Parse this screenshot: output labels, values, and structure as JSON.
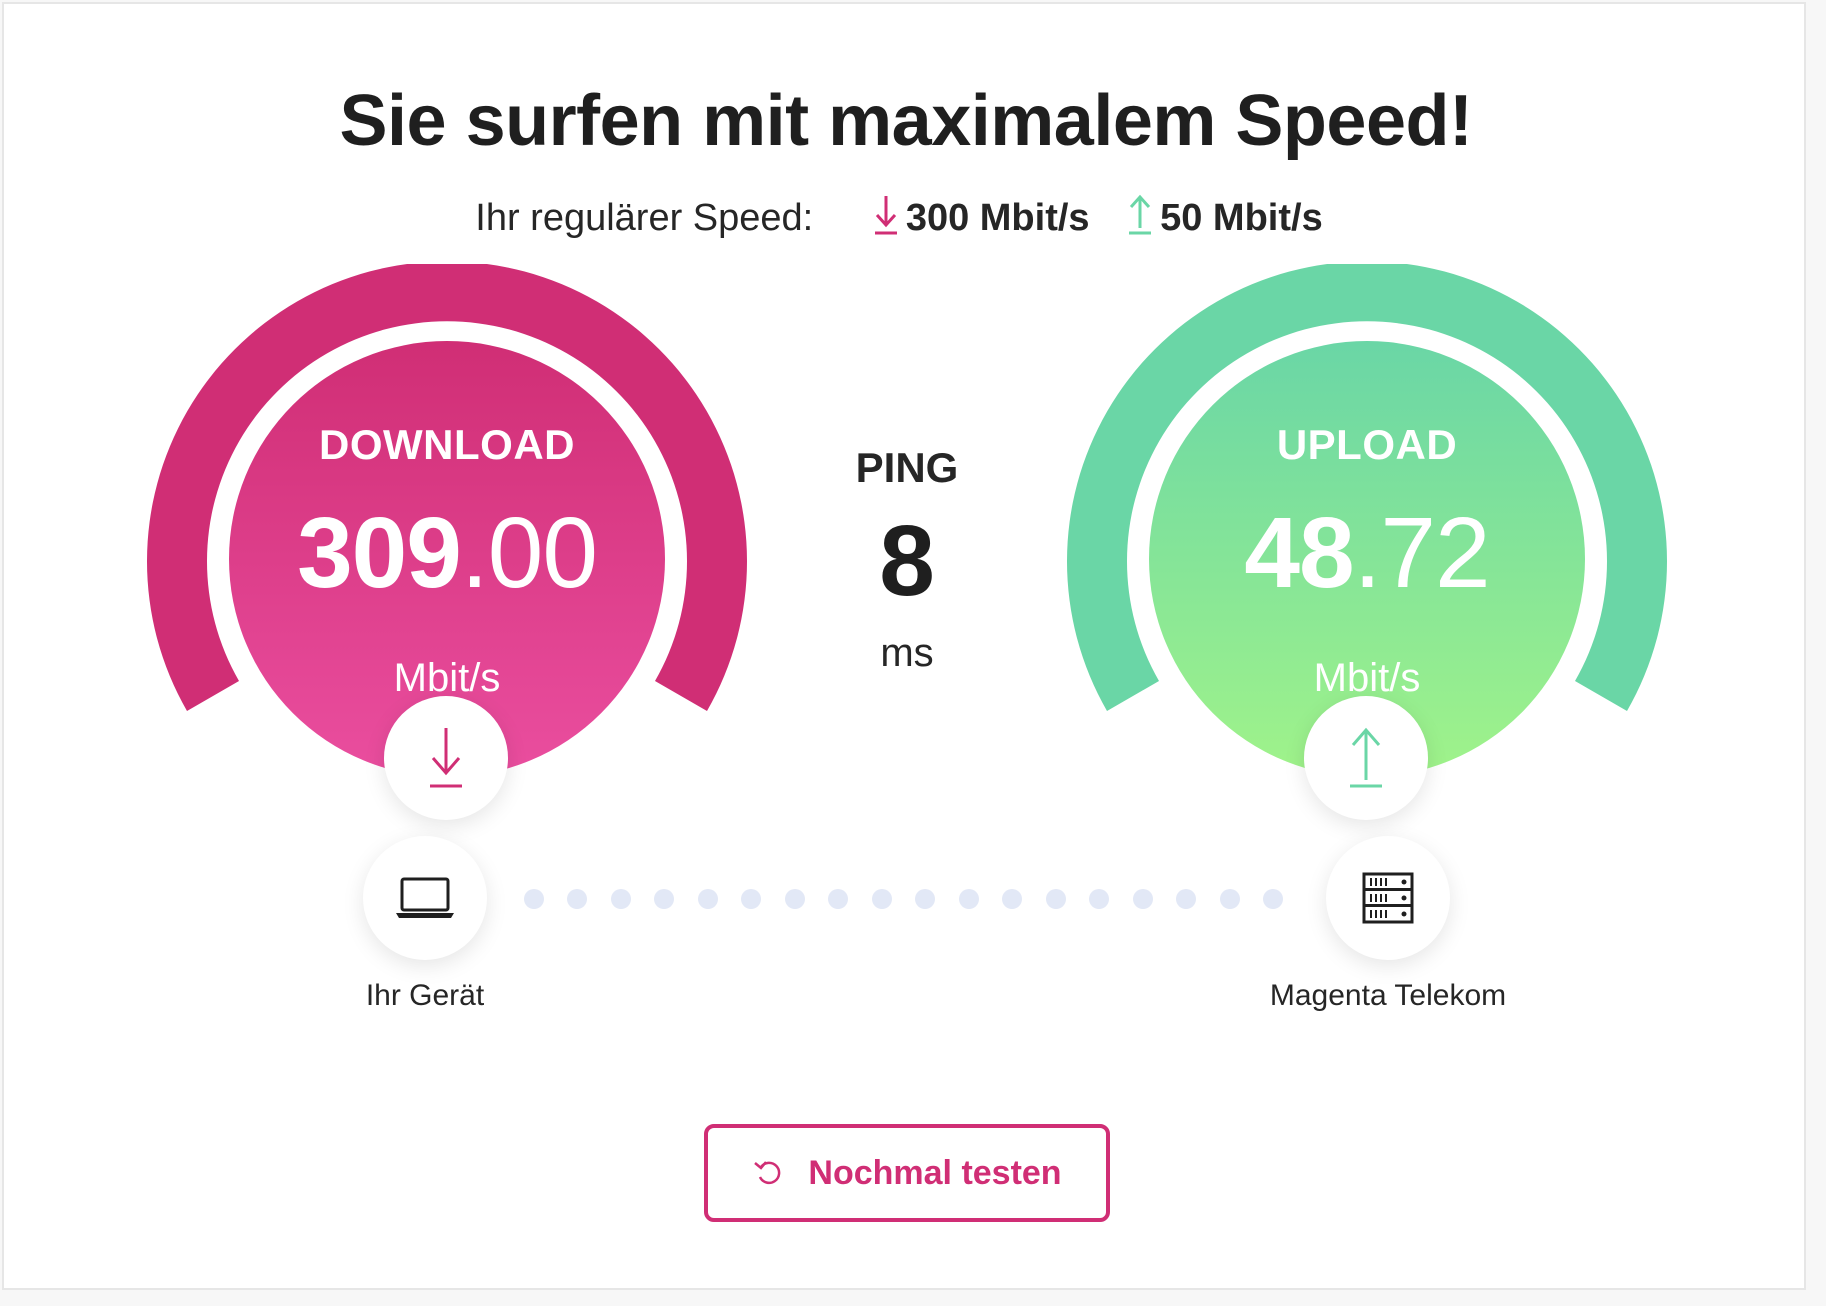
{
  "headline": "Sie surfen mit maximalem Speed!",
  "regular_speed": {
    "label": "Ihr regulärer Speed:",
    "download": "300 Mbit/s",
    "upload": "50 Mbit/s"
  },
  "download": {
    "label": "DOWNLOAD",
    "value_int": "309",
    "value_dec": ".00",
    "unit": "Mbit/s",
    "icon": "arrow-down-icon"
  },
  "upload": {
    "label": "UPLOAD",
    "value_int": "48",
    "value_dec": ".72",
    "unit": "Mbit/s",
    "icon": "arrow-up-icon"
  },
  "ping": {
    "label": "PING",
    "value": "8",
    "unit": "ms"
  },
  "connection": {
    "device_label": "Ihr Gerät",
    "device_icon": "laptop-icon",
    "server_label": "Magenta Telekom",
    "server_icon": "server-icon"
  },
  "retest_button": {
    "label": "Nochmal testen",
    "icon": "reload-icon"
  },
  "colors": {
    "magenta": "#d02e75",
    "magenta_light": "#e94a98",
    "green": "#6ad6a6",
    "green_light": "#9ef28c",
    "dot": "#e2e8f6"
  }
}
